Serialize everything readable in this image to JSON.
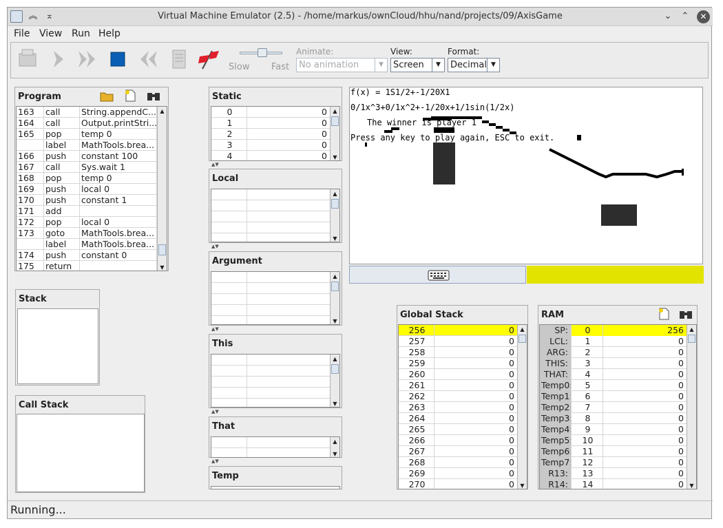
{
  "window": {
    "title": "Virtual Machine Emulator (2.5) - /home/markus/ownCloud/hhu/nand/projects/09/AxisGame"
  },
  "menu": [
    "File",
    "View",
    "Run",
    "Help"
  ],
  "toolbar": {
    "slow_label": "Slow",
    "fast_label": "Fast",
    "animate_label": "Animate:",
    "animate_value": "No animation",
    "view_label": "View:",
    "view_value": "Screen",
    "format_label": "Format:",
    "format_value": "Decimal"
  },
  "program": {
    "title": "Program",
    "rows": [
      [
        "163",
        "call",
        "String.appendC..."
      ],
      [
        "164",
        "call",
        "Output.printStri..."
      ],
      [
        "165",
        "pop",
        "temp 0"
      ],
      [
        "",
        "label",
        "MathTools.brea..."
      ],
      [
        "166",
        "push",
        "constant 100"
      ],
      [
        "167",
        "call",
        "Sys.wait 1"
      ],
      [
        "168",
        "pop",
        "temp 0"
      ],
      [
        "169",
        "push",
        "local 0"
      ],
      [
        "170",
        "push",
        "constant 1"
      ],
      [
        "171",
        "add",
        ""
      ],
      [
        "172",
        "pop",
        "local 0"
      ],
      [
        "173",
        "goto",
        "MathTools.brea..."
      ],
      [
        "",
        "label",
        "MathTools.brea..."
      ],
      [
        "174",
        "push",
        "constant 0"
      ],
      [
        "175",
        "return",
        ""
      ]
    ]
  },
  "stack": {
    "title": "Stack"
  },
  "call_stack": {
    "title": "Call Stack"
  },
  "static": {
    "title": "Static",
    "rows": [
      [
        "0",
        "0"
      ],
      [
        "1",
        "0"
      ],
      [
        "2",
        "0"
      ],
      [
        "3",
        "0"
      ],
      [
        "4",
        "0"
      ]
    ]
  },
  "local": {
    "title": "Local"
  },
  "argument": {
    "title": "Argument"
  },
  "this": {
    "title": "This"
  },
  "that": {
    "title": "That"
  },
  "temp": {
    "title": "Temp"
  },
  "screen": {
    "line1": "f(x) = 1S1/2+-1/20X1",
    "line2": "0/1x^3+0/1x^2+-1/20x+1/1sin(1/2x)",
    "line3": "The winner is player 1",
    "line4": "Press any key to play again, ESC to exit."
  },
  "global_stack": {
    "title": "Global Stack",
    "rows": [
      [
        "256",
        "0"
      ],
      [
        "257",
        "0"
      ],
      [
        "258",
        "0"
      ],
      [
        "259",
        "0"
      ],
      [
        "260",
        "0"
      ],
      [
        "261",
        "0"
      ],
      [
        "262",
        "0"
      ],
      [
        "263",
        "0"
      ],
      [
        "264",
        "0"
      ],
      [
        "265",
        "0"
      ],
      [
        "266",
        "0"
      ],
      [
        "267",
        "0"
      ],
      [
        "268",
        "0"
      ],
      [
        "269",
        "0"
      ],
      [
        "270",
        "0"
      ]
    ]
  },
  "ram": {
    "title": "RAM",
    "rows": [
      [
        "SP:",
        "0",
        "256"
      ],
      [
        "LCL:",
        "1",
        "0"
      ],
      [
        "ARG:",
        "2",
        "0"
      ],
      [
        "THIS:",
        "3",
        "0"
      ],
      [
        "THAT:",
        "4",
        "0"
      ],
      [
        "Temp0:",
        "5",
        "0"
      ],
      [
        "Temp1:",
        "6",
        "0"
      ],
      [
        "Temp2:",
        "7",
        "0"
      ],
      [
        "Temp3:",
        "8",
        "0"
      ],
      [
        "Temp4:",
        "9",
        "0"
      ],
      [
        "Temp5:",
        "10",
        "0"
      ],
      [
        "Temp6:",
        "11",
        "0"
      ],
      [
        "Temp7:",
        "12",
        "0"
      ],
      [
        "R13:",
        "13",
        "0"
      ],
      [
        "R14:",
        "14",
        "0"
      ]
    ]
  },
  "status": "Running..."
}
